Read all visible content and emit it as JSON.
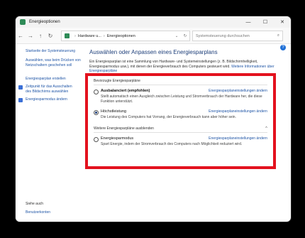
{
  "window": {
    "title": "Energieoptionen",
    "controls": {
      "minimize": "—",
      "maximize": "☐",
      "close": "✕"
    }
  },
  "nav": {
    "back": "←",
    "forward": "→",
    "up": "↑",
    "refresh_small": "↻",
    "breadcrumb": [
      "Hardware u...",
      "Energieoptionen"
    ],
    "breadcrumb_sep": "›",
    "dropdown": "⌄",
    "refresh": "↻",
    "search_placeholder": "Systemsteuerung durchsuchen",
    "search_icon": "⌕"
  },
  "sidebar": {
    "items": [
      "Startseite der Systemsteuerung",
      "Auswählen, was beim Drücken von Netzschaltern geschehen soll",
      "Energiesparplan erstellen",
      "Zeitpunkt für das Ausschalten des Bildschirms auswählen",
      "Energiesparmodus ändern"
    ],
    "see_also": "Siehe auch",
    "user_accounts": "Benutzerkonten"
  },
  "help": "?",
  "main": {
    "heading": "Auswählen oder Anpassen eines Energiesparplans",
    "intro": "Ein Energiesparplan ist eine Sammlung von Hardware- und Systemeinstellungen (z. B. Bildschirmhelligkeit, Energiesparmodus usw.), mit denen der Energieverbrauch des Computers gesteuert wird.",
    "intro_link": "Weitere Informationen über Energiesparpläne"
  },
  "plans": {
    "preferred_title": "Bevorzugte Energiesparpläne",
    "balanced": {
      "name": "Ausbalanciert (empfohlen)",
      "desc": "Stellt automatisch einen Ausgleich zwischen Leistung und Stromverbrauch der Hardware her, die diese Funktion unterstützt.",
      "link": "Energiesparplaneinstellungen ändern",
      "selected": false
    },
    "high": {
      "name": "Höchstleistung",
      "desc": "Die Leistung des Computers hat Vorrang, der Energieverbrauch kann aber höher sein.",
      "link": "Energiesparplaneinstellungen ändern",
      "selected": true
    },
    "hide_more": "Weitere Energiesparpläne ausblenden",
    "chev_up": "^",
    "saver": {
      "name": "Energiesparmodus",
      "desc": "Spart Energie, indem der Stromverbrauch des Computers nach Möglichkeit reduziert wird.",
      "link": "Energiesparplaneinstellungen ändern",
      "selected": false
    }
  }
}
